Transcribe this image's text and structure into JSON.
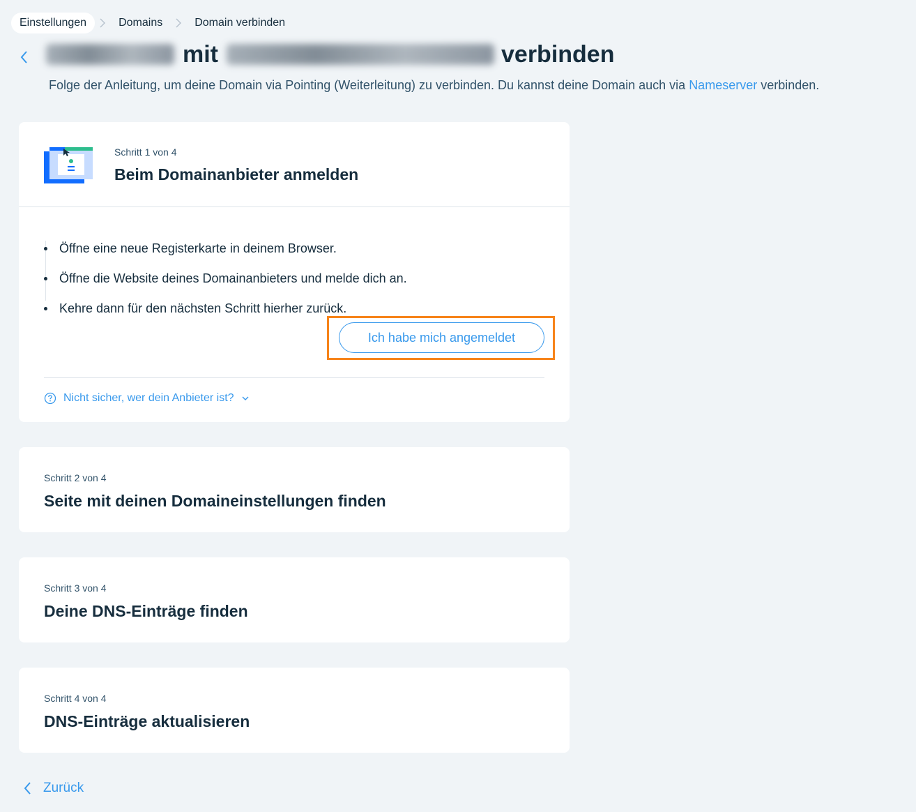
{
  "breadcrumb": {
    "items": [
      "Einstellungen",
      "Domains",
      "Domain verbinden"
    ]
  },
  "header": {
    "title_middle": "mit",
    "title_end": "verbinden",
    "subtitle_before": "Folge der Anleitung, um deine Domain via Pointing (Weiterleitung) zu verbinden. Du kannst deine Domain auch via ",
    "subtitle_link": "Nameserver",
    "subtitle_after": " verbinden."
  },
  "step1": {
    "label": "Schritt 1 von 4",
    "title": "Beim Domainanbieter anmelden",
    "bullets": [
      "Öffne eine neue Registerkarte in deinem Browser.",
      "Öffne die Website deines Domainanbieters und melde dich an.",
      "Kehre dann für den nächsten Schritt hierher zurück."
    ],
    "button_label": "Ich habe mich angemeldet",
    "help_label": "Nicht sicher, wer dein Anbieter ist?"
  },
  "step2": {
    "label": "Schritt 2 von 4",
    "title": "Seite mit deinen Domaineinstellungen finden"
  },
  "step3": {
    "label": "Schritt 3 von 4",
    "title": "Deine DNS-Einträge finden"
  },
  "step4": {
    "label": "Schritt 4 von 4",
    "title": "DNS-Einträge aktualisieren"
  },
  "footer": {
    "back_label": "Zurück"
  },
  "colors": {
    "accent": "#3899ec",
    "highlight": "#f7841a",
    "text": "#162d3d",
    "background": "#f0f4f7"
  }
}
